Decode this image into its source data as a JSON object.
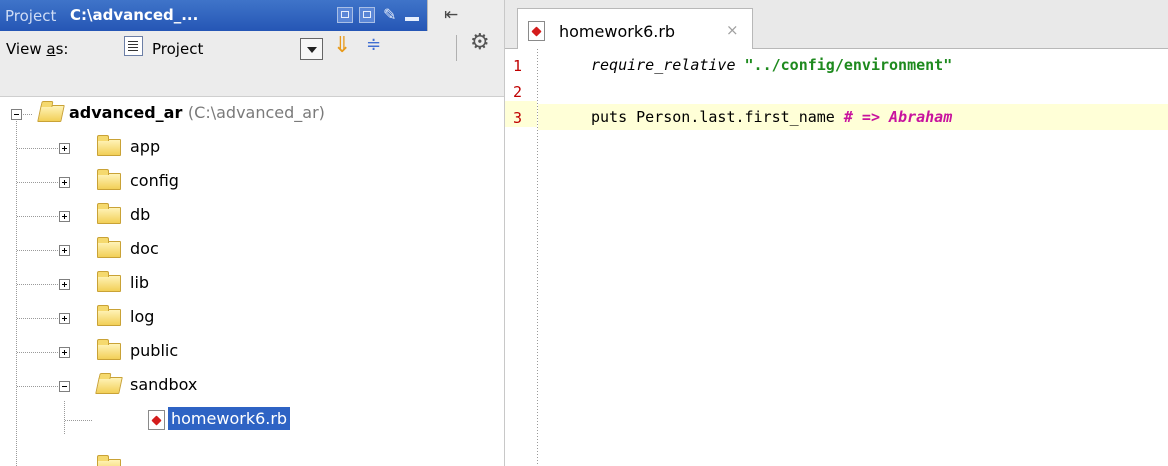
{
  "project_panel": {
    "title_label": "Project",
    "title_path": "C:\\advanced_...",
    "view_as_prefix": "View ",
    "view_as_accel": "a",
    "view_as_suffix": "s:",
    "view_mode": "Project",
    "tree": {
      "root_name": "advanced_ar",
      "root_path": "(C:\\advanced_ar)",
      "folders": [
        "app",
        "config",
        "db",
        "doc",
        "lib",
        "log",
        "public",
        "sandbox"
      ],
      "open_folder": "sandbox",
      "selected_file": "homework6.rb"
    }
  },
  "editor": {
    "tab_label": "homework6.rb",
    "tab_close": "×",
    "line_numbers": [
      "1",
      "2",
      "3"
    ],
    "lines": {
      "l1_keyword": "require_relative",
      "l1_string": "\"../config/environment\"",
      "l3_code": "puts Person.last.first_name ",
      "l3_comment": "# => Abraham"
    },
    "current_line": 3,
    "colors": {
      "string": "#1e8a1e",
      "comment": "#c8139e",
      "current_line_bg": "#ffffd7",
      "selection": "#2e63c4"
    }
  }
}
